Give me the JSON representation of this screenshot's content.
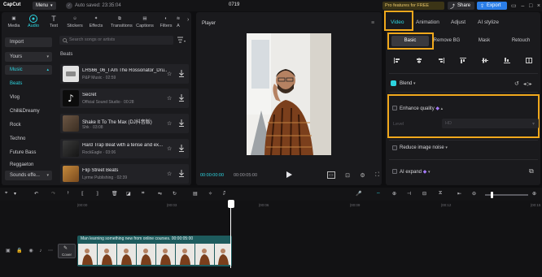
{
  "titlebar": {
    "logo": "CapCut",
    "menu_label": "Menu",
    "autosave": "Auto saved: 23:35:04",
    "project_name": "0719",
    "promo": "Pro features for FREE",
    "share_label": "Share",
    "export_label": "Export"
  },
  "left_panel": {
    "top_tabs": [
      "Media",
      "Audio",
      "Text",
      "Stickers",
      "Effects",
      "Transitions",
      "Captions",
      "Filters",
      "A"
    ],
    "categories": [
      "Import",
      "Yours",
      "Music",
      "Beats",
      "Vlog",
      "Chill&Dreamy",
      "Rock",
      "Techno",
      "Future Bass",
      "Reggaeton",
      "Sounds effe..."
    ],
    "search_placeholder": "Search songs or artists",
    "section_label": "Beats",
    "tracks": [
      {
        "title": "LHS66_06_I Am The Rossonator_Dru...",
        "meta": "P&P Music · 02:59",
        "color": "#d9d9d9"
      },
      {
        "title": "Secret",
        "meta": "Official Sound Studio · 00:28",
        "color": "#111111"
      },
      {
        "title": "Shake It To The Max  (DJ抖音版)",
        "meta": "Shk · 03:08",
        "color": "#5a4a3a"
      },
      {
        "title": "Hard Trap Beat with a tense and ex...",
        "meta": "RockEagle · 03:06",
        "color": "#2a2a2a"
      },
      {
        "title": "Flip Street Beats",
        "meta": "Lyrme Publishing · 02:39",
        "color": "#a86e2e"
      }
    ]
  },
  "player": {
    "title": "Player",
    "time_current": "00:00:00:00",
    "time_total": "00:00:05:00"
  },
  "right_panel": {
    "tabs": [
      "Video",
      "Animation",
      "Adjust",
      "AI stylize"
    ],
    "subtabs": [
      "Basic",
      "Remove BG",
      "Mask",
      "Retouch"
    ],
    "blend_label": "Blend",
    "enhance_label": "Enhance quality",
    "level_label": "Level",
    "level_value": "HD",
    "reduce_label": "Reduce image noise",
    "ai_expand_label": "AI expand"
  },
  "timeline": {
    "ticks": [
      "|00:00",
      "|00:03",
      "|00:06",
      "|00:09",
      "|00:12",
      "|00:15"
    ],
    "cover_label": "Cover",
    "clip_label": "Man learning something new from online courses.  00:00:05:00"
  },
  "colors": {
    "accent": "#2dd4e0",
    "highlight": "#f0a81c",
    "export_blue": "#2b7ee8",
    "clip_teal": "#1d5b5d"
  }
}
